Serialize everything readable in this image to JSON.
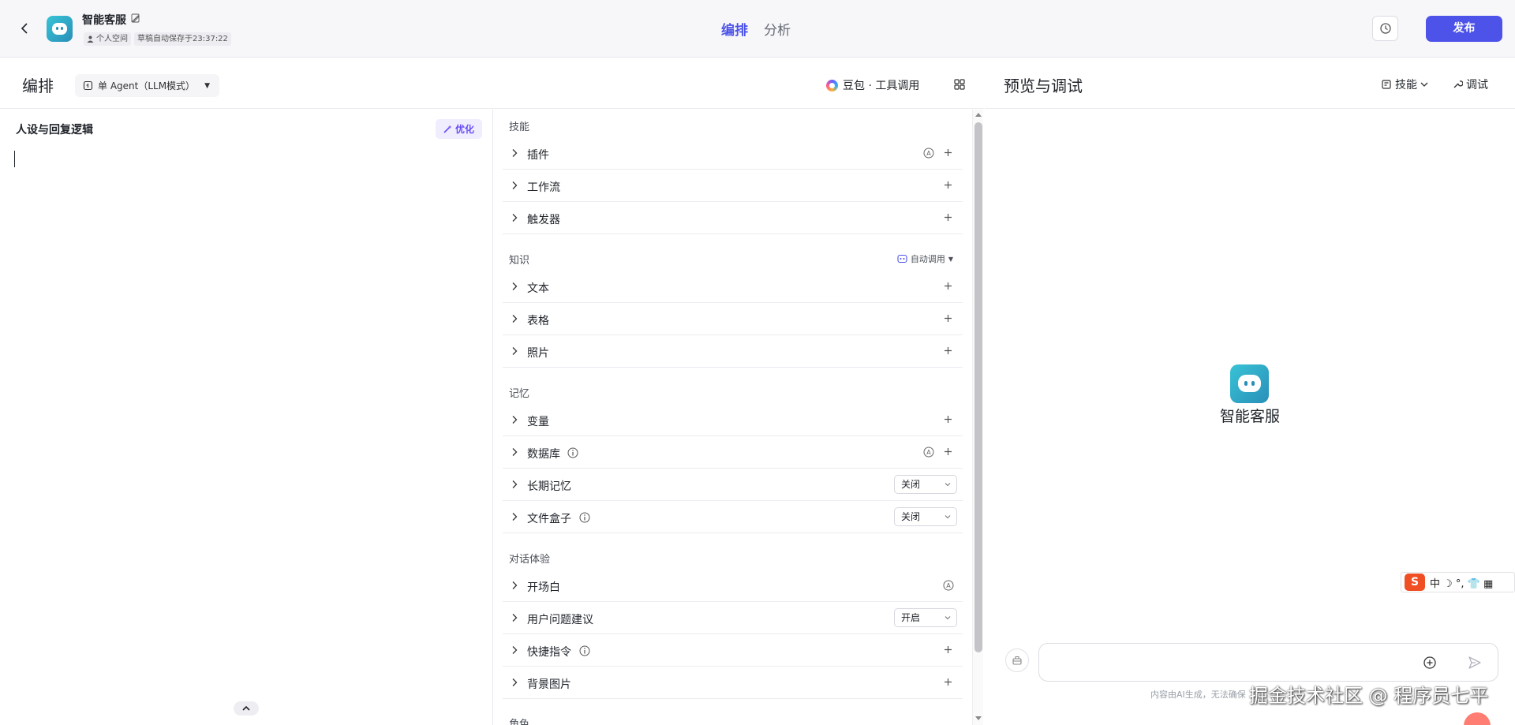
{
  "header": {
    "app_name": "智能客服",
    "space_tag": "个人空间",
    "saved_tag": "草稿自动保存于23:37:22",
    "tabs": [
      {
        "label": "编排",
        "active": true
      },
      {
        "label": "分析",
        "active": false
      }
    ],
    "publish_label": "发布"
  },
  "editor": {
    "title": "编排",
    "mode_label": "单 Agent（LLM模式）",
    "model_label": "豆包 · 工具调用"
  },
  "persona": {
    "title": "人设与回复逻辑",
    "optimize_label": "优化"
  },
  "skills": {
    "groups": {
      "skills": "技能",
      "knowledge": "知识",
      "memory": "记忆",
      "dialog": "对话体验",
      "role": "角色"
    },
    "auto_call_label": "自动调用",
    "items": {
      "plugin": "插件",
      "workflow": "工作流",
      "trigger": "触发器",
      "text": "文本",
      "table": "表格",
      "photo": "照片",
      "variable": "变量",
      "database": "数据库",
      "long_memory": "长期记忆",
      "file_box": "文件盒子",
      "opening": "开场白",
      "suggestion": "用户问题建议",
      "shortcut": "快捷指令",
      "background": "背景图片"
    },
    "selects": {
      "long_memory": "关闭",
      "file_box": "关闭",
      "suggestion": "开启"
    }
  },
  "preview": {
    "title": "预览与调试",
    "skills_label": "技能",
    "debug_label": "调试",
    "bot_name": "智能客服",
    "input_placeholder": "",
    "disclaimer": "内容由AI生成，无法确保",
    "watermark": "掘金技术社区 @ 程序员七平",
    "ime_label": "中 ☽ °, 👕 ▦"
  },
  "colors": {
    "accent": "#4d53e8",
    "optimize": "#6b4cf6"
  }
}
